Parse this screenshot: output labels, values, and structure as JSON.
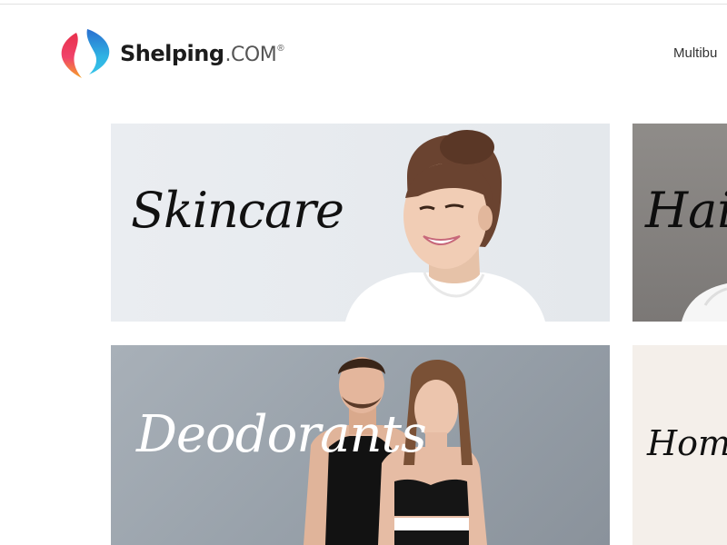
{
  "header": {
    "brand": "Shelping",
    "tld": ".COM",
    "reg_mark": "®",
    "nav": {
      "first_item": "Multibu"
    }
  },
  "tiles": [
    {
      "label": "Skincare"
    },
    {
      "label": "Hair"
    },
    {
      "label": "Deodorants"
    },
    {
      "label": "Home"
    }
  ],
  "colors": {
    "logo_red": "#e8304c",
    "logo_orange": "#f59a2a",
    "logo_cyan": "#2fb2e3",
    "logo_blue": "#2a6fd0"
  }
}
